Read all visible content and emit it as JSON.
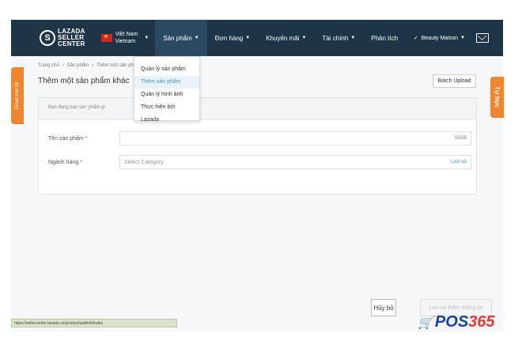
{
  "header": {
    "brand_line1": "LAZADA",
    "brand_line2": "SELLER",
    "brand_line3": "CENTER",
    "country_line1": "Việt Nam",
    "country_line2": "Vietnam",
    "nav": [
      {
        "label": "Sản phẩm"
      },
      {
        "label": "Đơn hàng"
      },
      {
        "label": "Khuyến mãi"
      },
      {
        "label": "Tài chính"
      },
      {
        "label": "Phân tích"
      }
    ],
    "account_name": "Beauty Maison"
  },
  "dropdown": {
    "items": [
      {
        "label": "Quản lý sản phẩm"
      },
      {
        "label": "Thêm sản phẩm"
      },
      {
        "label": "Quản lý hình ảnh"
      },
      {
        "label": "Thực hiện bởi Lazada"
      }
    ]
  },
  "breadcrumb": [
    "Trang chủ",
    "Sản phẩm",
    "Thêm một sản phẩ"
  ],
  "page_title": "Thêm một sản phẩm khác",
  "batch_upload_label": "Batch Upload",
  "form": {
    "card_hint": "Bạn đang bán sản phẩm gì",
    "name_label": "Tên sản phẩm",
    "name_value": "",
    "name_counter": "0/255",
    "category_label": "Ngành hàng",
    "category_placeholder": "Select Category",
    "history_link": "Lịch sử",
    "required_mark": "*"
  },
  "footer": {
    "cancel_label": "Hủy bỏ",
    "submit_label": "Lưu và thêm thông tin"
  },
  "side_tabs": {
    "left": "Email cho tôi",
    "right": "Tự học"
  },
  "status_url": "https://sellercenter.lazada.vn/product/publish/index",
  "watermark": {
    "prefix": "POS",
    "suffix": "365"
  },
  "colors": {
    "topbar": "#1d3547",
    "accent_orange": "#f0852d",
    "link_blue": "#4a90c8",
    "required_red": "#e04b3a"
  }
}
